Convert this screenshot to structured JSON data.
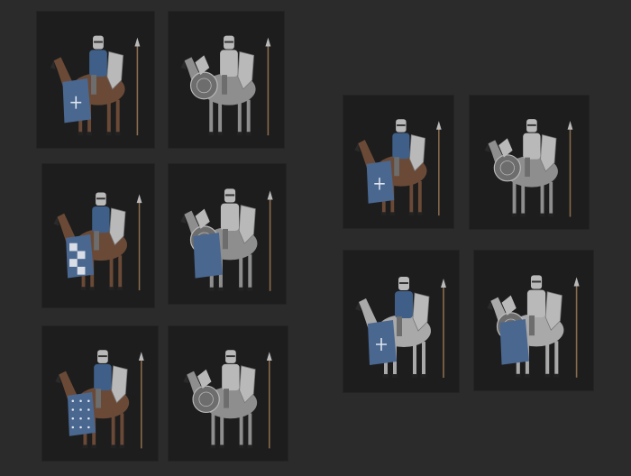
{
  "title": "",
  "colors": {
    "page_bg": "#2b2b2b",
    "tile_bg": "#1d1d1d",
    "steel": "#b9b9b9",
    "steel_dark": "#6d6d6d",
    "blue_tabard": "#3f5f88",
    "blue_caparison": "#4a6790",
    "brown_horse": "#6a4a37",
    "gray_horse": "#8e8e8e",
    "white_horse": "#a9a9a9"
  },
  "variants": [
    {
      "id": "v1",
      "knight": "blue-tabard",
      "horse": "brown",
      "barding": "blue-cross"
    },
    {
      "id": "v2",
      "knight": "full-plate",
      "horse": "gray",
      "barding": "armored-plate"
    },
    {
      "id": "v3",
      "knight": "blue-tabard",
      "horse": "brown",
      "barding": "blue-white-check"
    },
    {
      "id": "v4",
      "knight": "full-plate",
      "horse": "gray",
      "barding": "plate-blue"
    },
    {
      "id": "v5",
      "knight": "blue-tabard",
      "horse": "brown",
      "barding": "blue-stars"
    },
    {
      "id": "v6",
      "knight": "full-plate",
      "horse": "gray",
      "barding": "armored-plate"
    },
    {
      "id": "v7",
      "knight": "blue-tabard",
      "horse": "brown",
      "barding": "blue-cross"
    },
    {
      "id": "v8",
      "knight": "full-plate",
      "horse": "gray",
      "barding": "armored-plate"
    },
    {
      "id": "v9",
      "knight": "blue-tabard",
      "horse": "white",
      "barding": "blue-cross"
    },
    {
      "id": "v10",
      "knight": "full-plate",
      "horse": "white",
      "barding": "armored-blue"
    }
  ]
}
